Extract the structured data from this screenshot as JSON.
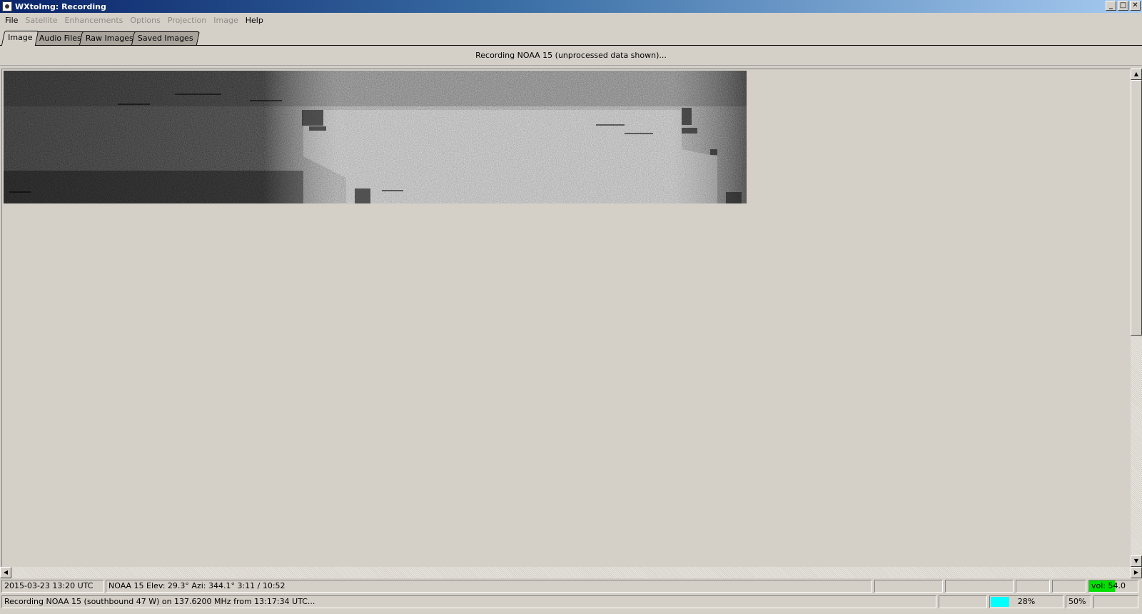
{
  "window": {
    "title": "WXtoImg: Recording",
    "icon": "wxtoimg-app-icon",
    "controls": {
      "minimize": "_",
      "maximize": "□",
      "close": "✕"
    }
  },
  "menu": [
    {
      "label": "File",
      "enabled": true
    },
    {
      "label": "Satellite",
      "enabled": false
    },
    {
      "label": "Enhancements",
      "enabled": false
    },
    {
      "label": "Options",
      "enabled": false
    },
    {
      "label": "Projection",
      "enabled": false
    },
    {
      "label": "Image",
      "enabled": false
    },
    {
      "label": "Help",
      "enabled": true
    }
  ],
  "tabs": [
    {
      "label": "Image",
      "active": true
    },
    {
      "label": "Audio Files",
      "active": false
    },
    {
      "label": "Raw Images",
      "active": false
    },
    {
      "label": "Saved Images",
      "active": false
    }
  ],
  "status_header": "Recording NOAA 15 (unprocessed data shown)...",
  "image": {
    "description_icon": "noaa-apt-image"
  },
  "status_bar": {
    "datetime": "2015-03-23  13:20 UTC",
    "satellite_info": "NOAA 15   Elev: 29.3°   Azi: 344.1°   3:11 / 10:52",
    "volume": {
      "label": "vol: 54.0",
      "level_fraction": 0.54
    },
    "recording_message": "Recording NOAA 15 (southbound 47 W) on 137.6200 MHz from 13:17:34 UTC...",
    "progress": {
      "label": "28%",
      "fraction": 0.28
    },
    "zoom": "50%"
  },
  "colors": {
    "titlebar_start": "#0a246a",
    "titlebar_end": "#a6caf0",
    "window_bg": "#d4d0c8",
    "volume_fill": "#00e000",
    "progress_fill": "#00ffff"
  }
}
